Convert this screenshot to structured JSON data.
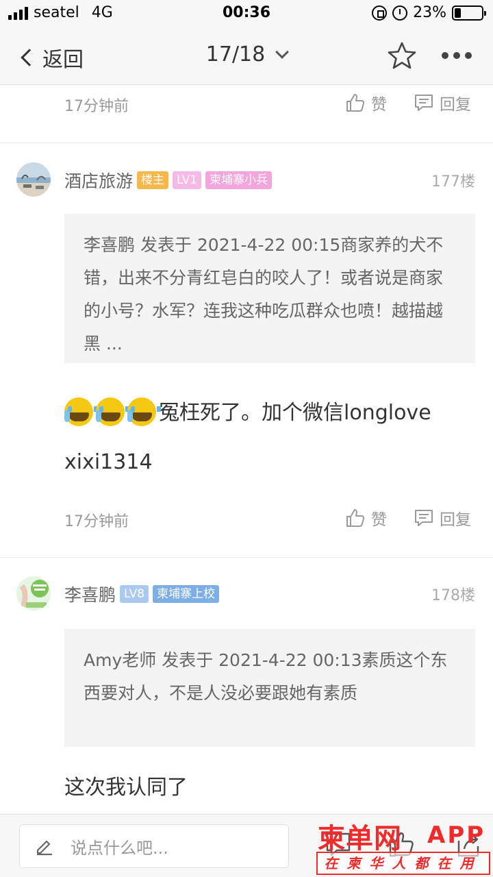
{
  "status_bar": {
    "carrier": "seatel",
    "network": "4G",
    "time": "00:36",
    "battery_percent_text": "23%",
    "battery_level": 0.23
  },
  "nav": {
    "back_label": "返回",
    "page_indicator": "17/18",
    "icons": [
      "chevron-left-icon",
      "chevron-down-icon",
      "star-icon",
      "more-icon"
    ]
  },
  "previous_post_tail": {
    "time": "17分钟前",
    "like_label": "赞",
    "reply_label": "回复"
  },
  "posts": [
    {
      "username": "酒店旅游",
      "badges": [
        "楼主",
        "LV1",
        "柬埔寨小兵"
      ],
      "floor": "177楼",
      "quote": "李喜鹏 发表于 2021-4-22 00:15商家养的犬不错，出来不分青红皂白的咬人了！或者说是商家的小号？水军？连我这种吃瓜群众也喷！越描越黑 ...",
      "body_line1": "冤枉死了。加个微信longlove",
      "body_line2": "xixi1314",
      "time": "17分钟前",
      "like_label": "赞",
      "reply_label": "回复"
    },
    {
      "username": "李喜鹏",
      "badges": [
        "LV8",
        "柬埔寨上校"
      ],
      "floor": "178楼",
      "quote": "Amy老师 发表于 2021-4-22 00:13素质这个东西要对人，不是人没必要跟她有素质",
      "body": "这次我认同了"
    }
  ],
  "bottom_bar": {
    "comment_placeholder": "说点什么吧...",
    "watermark": {
      "brand": "柬单网",
      "app": "APP",
      "slogan": "在柬华人都在用"
    }
  },
  "colors": {
    "badge_host": "#f7b84b",
    "badge_lv1": "#f6b9e8",
    "badge_rank1": "#f4a5dc",
    "badge_lv8": "#a9c9ef",
    "badge_rank2": "#7eaee6",
    "watermark_red": "#ef2b2b"
  }
}
